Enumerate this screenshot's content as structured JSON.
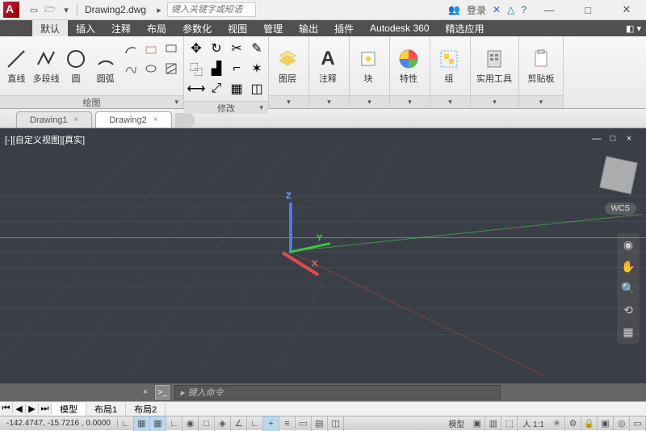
{
  "title": "Drawing2.dwg",
  "search_placeholder": "键入关键字或短语",
  "login_label": "登录",
  "menus": [
    "默认",
    "插入",
    "注释",
    "布局",
    "参数化",
    "视图",
    "管理",
    "输出",
    "插件",
    "Autodesk 360",
    "精选应用"
  ],
  "active_menu": 0,
  "panels": {
    "draw": {
      "title": "绘图",
      "big": [
        {
          "name": "line",
          "label": "直线"
        },
        {
          "name": "polyline",
          "label": "多段线"
        },
        {
          "name": "circle",
          "label": "圆"
        },
        {
          "name": "arc",
          "label": "圆弧"
        }
      ],
      "small": [
        "arc2",
        "box",
        "rect",
        "spline",
        "ellipse",
        "hatch"
      ]
    },
    "modify": {
      "title": "修改",
      "small": [
        "move",
        "rotate",
        "trim",
        "copy",
        "mirror",
        "fillet",
        "stretch",
        "scale",
        "array",
        "erase",
        "explode",
        "offset"
      ]
    },
    "layer": {
      "label": "图层"
    },
    "annotate": {
      "label": "注释"
    },
    "block": {
      "label": "块"
    },
    "props": {
      "label": "特性"
    },
    "group": {
      "label": "组"
    },
    "utils": {
      "label": "实用工具"
    },
    "clip": {
      "label": "剪贴板"
    }
  },
  "doctabs": [
    {
      "label": "Drawing1",
      "active": false
    },
    {
      "label": "Drawing2",
      "active": true
    }
  ],
  "viewport_label": "[-][自定义视图][真实]",
  "wcs_label": "WCS",
  "axes": {
    "x": "X",
    "y": "Y",
    "z": "Z"
  },
  "cmd_placeholder": "键入命令",
  "layout_tabs": [
    "模型",
    "布局1",
    "布局2"
  ],
  "active_layout": 0,
  "coords": "-142.4747, -15.7216 , 0.0000",
  "status_model": "模型",
  "status_scale": "人 1:1"
}
